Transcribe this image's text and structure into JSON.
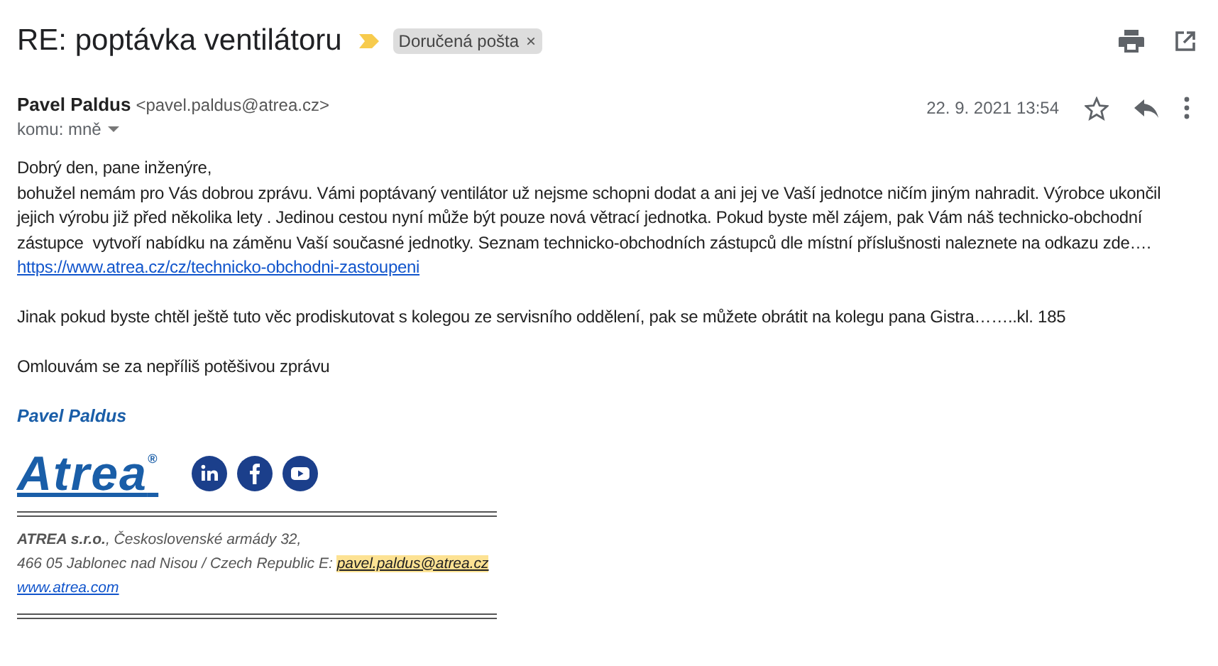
{
  "subject": "RE: poptávka ventilátoru",
  "important": true,
  "label": {
    "text": "Doručená pošta",
    "remove": "×"
  },
  "sender": {
    "name": "Pavel Paldus",
    "email": "<pavel.paldus@atrea.cz>"
  },
  "recipient": "komu: mně",
  "date": "22. 9. 2021 13:54",
  "starred": false,
  "body": {
    "greeting": "Dobrý den, pane inženýre,",
    "lines": [
      "bohužel nemám pro Vás dobrou zprávu. Vámi poptávaný ventilátor už nejsme schopni dodat a ani jej ve Vaší jednotce ničím jiným nahradit. Výrobce ukončil",
      "jejich výrobu již před několika lety . Jedinou cestou nyní může být pouze nová větrací jednotka. Pokud byste měl zájem, pak Vám náš technicko-obchodní",
      "zástupce  vytvoří nabídku na záměnu Vaší současné jednotky. Seznam technicko-obchodních zástupců dle místní příslušnosti naleznete na odkazu zde…."
    ],
    "link": "https://www.atrea.cz/cz/technicko-obchodni-zastoupeni",
    "paragraphs": [
      "Jinak pokud byste chtěl ještě tuto věc prodiskutovat s kolegou ze servisního oddělení, pak se můžete obrátit na kolegu pana Gistra……..kl. 185",
      "Omlouvám se za nepříliš potěšivou zprávu"
    ]
  },
  "signature": {
    "name": "Pavel Paldus",
    "logo": "Atrea",
    "registered": "®",
    "address": "**ATREA s.r.o.**, Československé armády 32,",
    "city": "466 05 Jablonec nad Nisou / Czech Republic E:",
    "email": "pavel.paldus@atrea.cz",
    "web": "www.atrea.com"
  }
}
